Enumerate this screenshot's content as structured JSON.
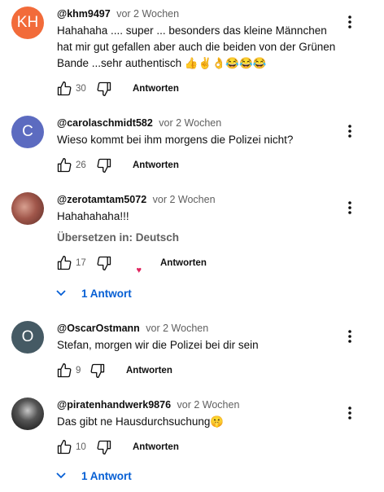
{
  "comments": [
    {
      "avatar_text": "KH",
      "avatar_color": "#f26b3a",
      "author": "@khm9497",
      "time": "vor 2 Wochen",
      "text": "Hahahaha .... super ... besonders das kleine Männchen hat mir gut gefallen aber auch die beiden von der Grünen Bande ...sehr authentisch 👍✌️👌😂😂😂",
      "likes": "30",
      "reply_label": "Antworten"
    },
    {
      "avatar_text": "C",
      "avatar_color": "#5c6bc0",
      "author": "@carolaschmidt582",
      "time": "vor 2 Wochen",
      "text": "Wieso kommt bei ihm morgens die Polizei nicht?",
      "likes": "26",
      "reply_label": "Antworten"
    },
    {
      "avatar_text": "",
      "avatar_color": "#8a5a4a",
      "author": "@zerotamtam5072",
      "time": "vor 2 Wochen",
      "text": "Hahahahaha!!!",
      "translate_label": "Übersetzen in: Deutsch",
      "likes": "17",
      "reply_label": "Antworten",
      "replies_label": "1 Antwort"
    },
    {
      "avatar_text": "O",
      "avatar_color": "#455a64",
      "author": "@OscarOstmann",
      "time": "vor 2 Wochen",
      "text": "Stefan, morgen wir die Polizei bei dir sein",
      "likes": "9",
      "reply_label": "Antworten"
    },
    {
      "avatar_text": "",
      "avatar_color": "#2b2b2b",
      "author": "@piratenhandwerk9876",
      "time": "vor 2 Wochen",
      "text": "Das gibt ne Hausdurchsuchung🤫",
      "likes": "10",
      "reply_label": "Antworten",
      "replies_label": "1 Antwort"
    }
  ]
}
